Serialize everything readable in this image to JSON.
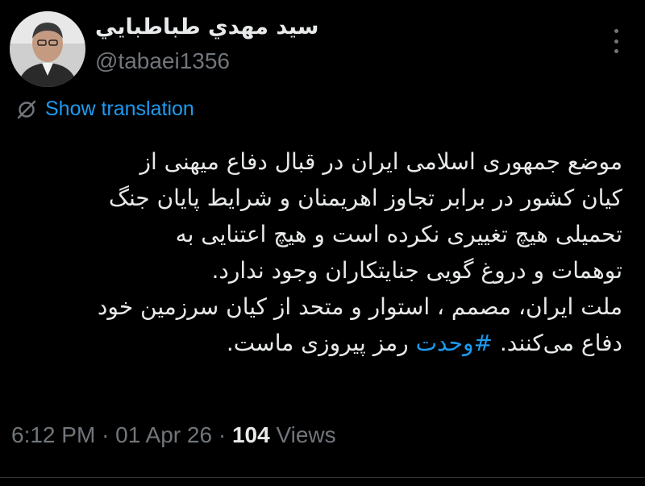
{
  "tweet": {
    "author": {
      "display_name": "سيد مهدي طباطبايي",
      "handle": "@tabaei1356",
      "avatar_icon": "user-avatar"
    },
    "more_icon": "more-options-icon",
    "translate": {
      "icon": "translate-icon",
      "label": "Show translation"
    },
    "body_lines": [
      "موضع جمهوری اسلامی ایران در قبال دفاع میهنی از",
      "کیان کشور در برابر تجاوز اهریمنان و شرایط پایان جنگ",
      "تحمیلی هیچ تغییری نکرده است و هیچ اعتنایی به",
      "توهمات و دروغ گویی جنایتکاران وجود ندارد.",
      "ملت ایران، مصمم ، استوار و متحد از کیان سرزمین خود"
    ],
    "last_line": {
      "prefix": "دفاع می‌کنند.",
      "hashtag": "#وحدت",
      "suffix": "رمز پیروزی ماست."
    },
    "meta": {
      "time": "6:12 PM",
      "separator": "·",
      "date": "01 Apr 26",
      "views_count": "104",
      "views_label": "Views"
    },
    "colors": {
      "background": "#000000",
      "text": "#e7e9ea",
      "secondary": "#71767b",
      "accent": "#1d9bf0"
    }
  }
}
